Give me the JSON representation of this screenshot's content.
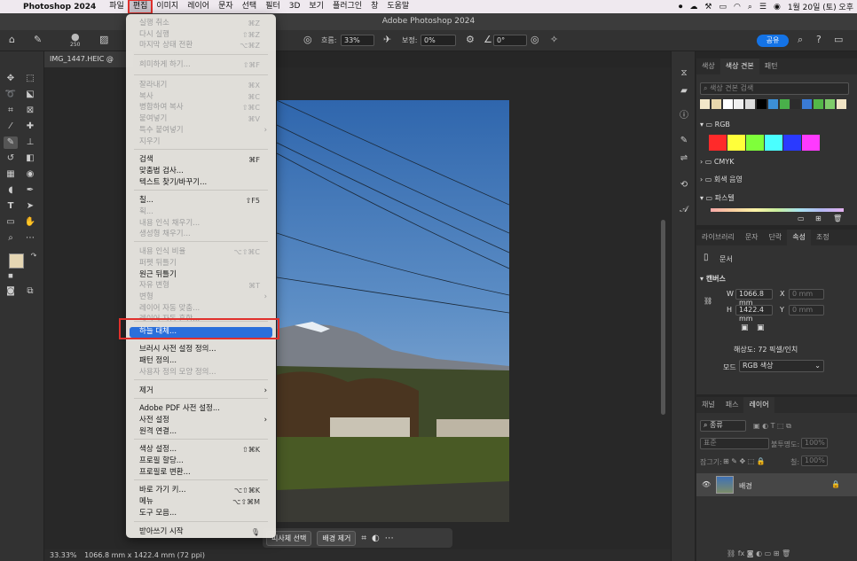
{
  "menubar": {
    "app": "Photoshop 2024",
    "items": [
      "파일",
      "편집",
      "이미지",
      "레이어",
      "문자",
      "선택",
      "필터",
      "3D",
      "보기",
      "플러그인",
      "창",
      "도움말"
    ],
    "active_index": 1,
    "clock": "1월 20일 (토) 오후"
  },
  "window": {
    "title": "Adobe Photoshop 2024"
  },
  "options": {
    "brush_size": "250",
    "flow_label": "흐름:",
    "flow_value": "33%",
    "smooth_label": "보정:",
    "smooth_value": "0%",
    "angle_value": "0°",
    "share": "공유"
  },
  "document": {
    "tab": "IMG_1447.HEIC @",
    "status_zoom": "33.33%",
    "status_info": "1066.8 mm x 1422.4 mm (72 ppi)"
  },
  "context_bar": {
    "subject": "피사체 선택",
    "remove_bg": "배경 제거"
  },
  "edit_menu": {
    "items": [
      {
        "label": "실행 취소",
        "shortcut": "⌘Z",
        "disabled": true
      },
      {
        "label": "다시 실행",
        "shortcut": "⇧⌘Z",
        "disabled": true
      },
      {
        "label": "마지막 상태 전환",
        "shortcut": "⌥⌘Z",
        "disabled": true
      },
      {
        "label": "희미하게 하기...",
        "shortcut": "⇧⌘F",
        "disabled": true
      },
      {
        "label": "잘라내기",
        "shortcut": "⌘X",
        "disabled": true
      },
      {
        "label": "복사",
        "shortcut": "⌘C",
        "disabled": true
      },
      {
        "label": "병합하여 복사",
        "shortcut": "⇧⌘C",
        "disabled": true
      },
      {
        "label": "붙여넣기",
        "shortcut": "⌘V",
        "disabled": true
      },
      {
        "label": "특수 붙여넣기",
        "submenu": true,
        "disabled": true
      },
      {
        "label": "지우기",
        "disabled": true
      },
      {
        "label": "검색",
        "shortcut": "⌘F",
        "disabled": false
      },
      {
        "label": "맞춤법 검사...",
        "disabled": false
      },
      {
        "label": "텍스트 찾기/바꾸기...",
        "disabled": false
      },
      {
        "label": "칠...",
        "shortcut": "⇧F5",
        "disabled": false
      },
      {
        "label": "획...",
        "disabled": true
      },
      {
        "label": "내용 인식 채우기...",
        "disabled": true
      },
      {
        "label": "생성형 채우기...",
        "disabled": true
      },
      {
        "label": "내용 인식 비율",
        "shortcut": "⌥⇧⌘C",
        "disabled": true
      },
      {
        "label": "퍼펫 뒤틀기",
        "disabled": true
      },
      {
        "label": "원근 뒤틀기",
        "disabled": false
      },
      {
        "label": "자유 변형",
        "shortcut": "⌘T",
        "disabled": true
      },
      {
        "label": "변형",
        "submenu": true,
        "disabled": true
      },
      {
        "label": "레이어 자동 맞춤...",
        "disabled": true
      },
      {
        "label": "레이어 자동 혼합...",
        "disabled": true
      },
      {
        "label": "하늘 대체...",
        "disabled": false,
        "highlighted": true
      },
      {
        "label": "브러시 사전 설정 정의...",
        "disabled": false
      },
      {
        "label": "패턴 정의...",
        "disabled": false
      },
      {
        "label": "사용자 정의 모양 정의...",
        "disabled": true
      },
      {
        "label": "제거",
        "submenu": true,
        "disabled": false
      },
      {
        "label": "Adobe PDF 사전 설정...",
        "disabled": false
      },
      {
        "label": "사전 설정",
        "submenu": true,
        "disabled": false
      },
      {
        "label": "원격 연결...",
        "disabled": false
      },
      {
        "label": "색상 설정...",
        "shortcut": "⇧⌘K",
        "disabled": false
      },
      {
        "label": "프로필 할당...",
        "disabled": false
      },
      {
        "label": "프로필로 변환...",
        "disabled": false
      },
      {
        "label": "바로 가기 키...",
        "shortcut": "⌥⇧⌘K",
        "disabled": false
      },
      {
        "label": "메뉴",
        "shortcut": "⌥⇧⌘M",
        "disabled": false
      },
      {
        "label": "도구 모음...",
        "disabled": false
      },
      {
        "label": "받아쓰기 시작",
        "disabled": false
      }
    ]
  },
  "swatches_panel": {
    "tabs": [
      "색상",
      "색상 견본",
      "패턴"
    ],
    "active_tab": 1,
    "search_placeholder": "색상 견본 검색",
    "recent_colors": [
      "#f2e7c9",
      "#e8d7ad",
      "#ffffff",
      "#f0f0f0",
      "#dcdcdc",
      "#000000",
      "#3c8fd6",
      "#49b04a",
      "#2c2c2c",
      "#3a7bd5",
      "#54b848",
      "#7fcc6a",
      "#f1e4c4"
    ],
    "groups": [
      "RGB",
      "CMYK",
      "회색 음영",
      "파스텔"
    ],
    "rgb_colors": [
      "#ff2a2a",
      "#ffff3a",
      "#7fff3a",
      "#4affff",
      "#2a3aff",
      "#ff3aff"
    ]
  },
  "properties_panel": {
    "tabs": [
      "라이브러리",
      "문자",
      "단락",
      "속성",
      "조정"
    ],
    "active_tab": 3,
    "doc_label": "문서",
    "section": "캔버스",
    "w_label": "W",
    "w_value": "1066.8 mm",
    "h_label": "H",
    "h_value": "1422.4 mm",
    "x_label": "X",
    "x_value": "0 mm",
    "y_label": "Y",
    "y_value": "0 mm",
    "resolution": "해상도: 72 픽셀/인치",
    "mode_label": "모드",
    "mode_value": "RGB 색상"
  },
  "layers_panel": {
    "tabs": [
      "채널",
      "패스",
      "레이어"
    ],
    "active_tab": 2,
    "filter": "종류",
    "blend": "표준",
    "opacity_label": "불투명도:",
    "opacity_value": "100%",
    "lock_label": "잠그기:",
    "fill_label": "칠:",
    "fill_value": "100%",
    "layer_name": "배경"
  }
}
